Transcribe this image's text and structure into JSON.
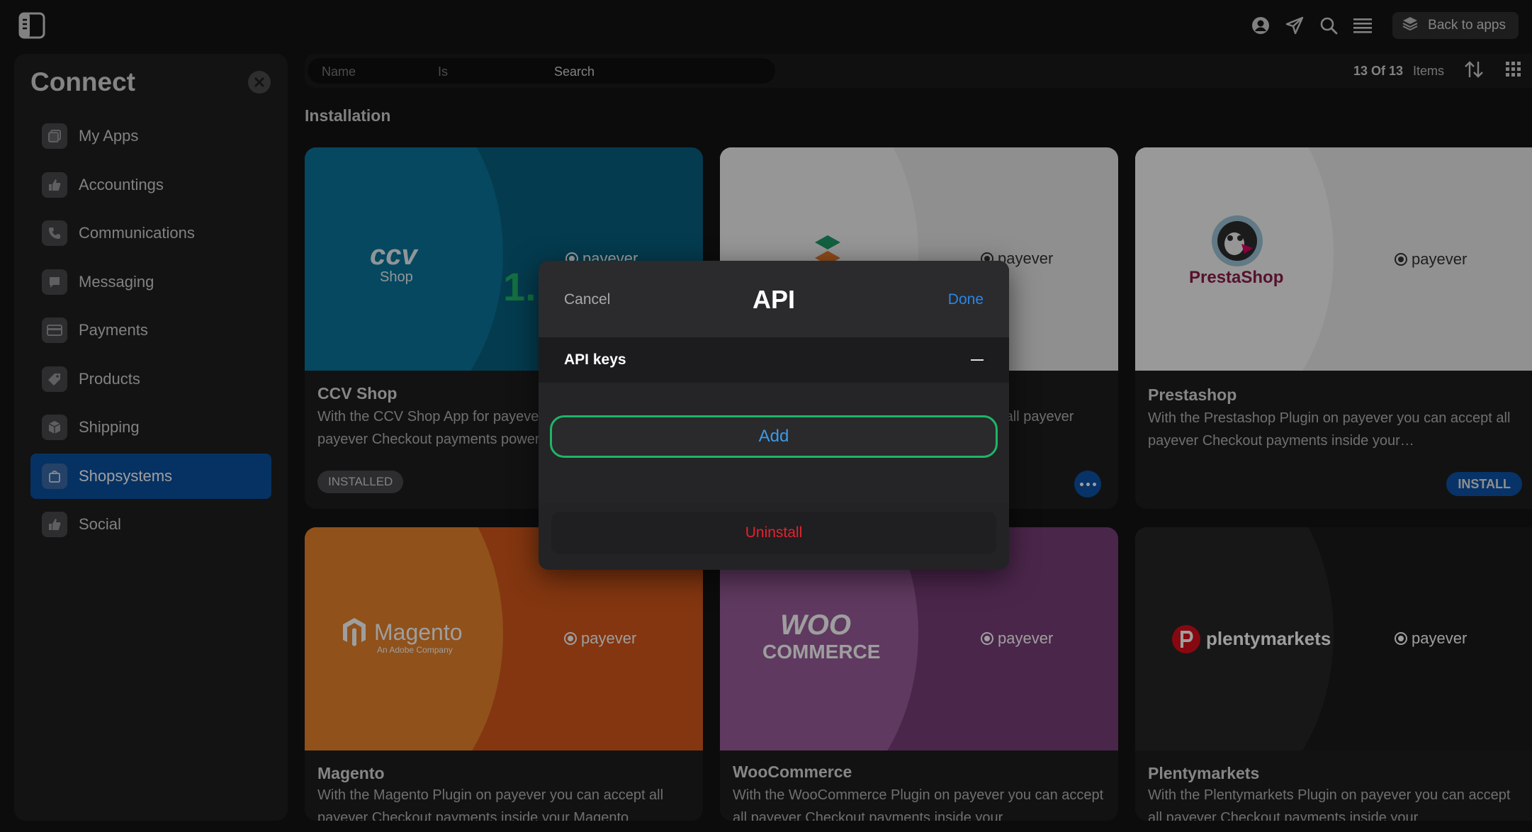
{
  "topbar": {
    "back_label": "Back to apps"
  },
  "sidebar": {
    "title": "Connect",
    "items": [
      {
        "label": "My Apps"
      },
      {
        "label": "Accountings"
      },
      {
        "label": "Communications"
      },
      {
        "label": "Messaging"
      },
      {
        "label": "Payments"
      },
      {
        "label": "Products"
      },
      {
        "label": "Shipping"
      },
      {
        "label": "Shopsystems",
        "active": true
      },
      {
        "label": "Social"
      }
    ]
  },
  "filter": {
    "field1": "Name",
    "field2": "Is",
    "field3": "Search",
    "count": "13 Of 13",
    "items_label": "Items"
  },
  "main": {
    "section_title": "Installation",
    "payever_label": "payever",
    "cards": [
      {
        "title": "CCV Shop",
        "desc": "With the CCV Shop App for payever you can accept all payever Checkout payments powered by payever inside your...",
        "status": "INSTALLED",
        "logo_text": "ccv",
        "logo_sub": "Shop"
      },
      {
        "title": "",
        "desc": "With the Plugin on payever you can accept all payever Checkout payments inside your...",
        "status": "more"
      },
      {
        "title": "Prestashop",
        "desc": "With the Prestashop Plugin on payever you can accept all payever Checkout payments inside your…",
        "status": "INSTALL",
        "logo_text": "PrestaShop"
      },
      {
        "title": "Magento",
        "desc": "With the Magento Plugin on payever you can accept all payever Checkout payments inside your Magento",
        "logo_text": "Magento",
        "logo_sub": "An Adobe Company"
      },
      {
        "title": "WooCommerce",
        "desc": "With the WooCommerce Plugin on payever you can accept all payever Checkout payments inside your",
        "logo_text": "WOO",
        "logo_sub": "COMMERCE"
      },
      {
        "title": "Plentymarkets",
        "desc": "With the Plentymarkets Plugin on payever you can accept all payever Checkout payments inside your",
        "logo_text": "plentymarkets"
      }
    ]
  },
  "step_marker": "1.",
  "modal": {
    "cancel": "Cancel",
    "title": "API",
    "done": "Done",
    "section": "API keys",
    "add": "Add",
    "uninstall": "Uninstall"
  },
  "colors": {
    "accent": "#0d53a8",
    "done": "#2a86e6",
    "add_border": "#1fb569",
    "danger": "#e5222f"
  }
}
